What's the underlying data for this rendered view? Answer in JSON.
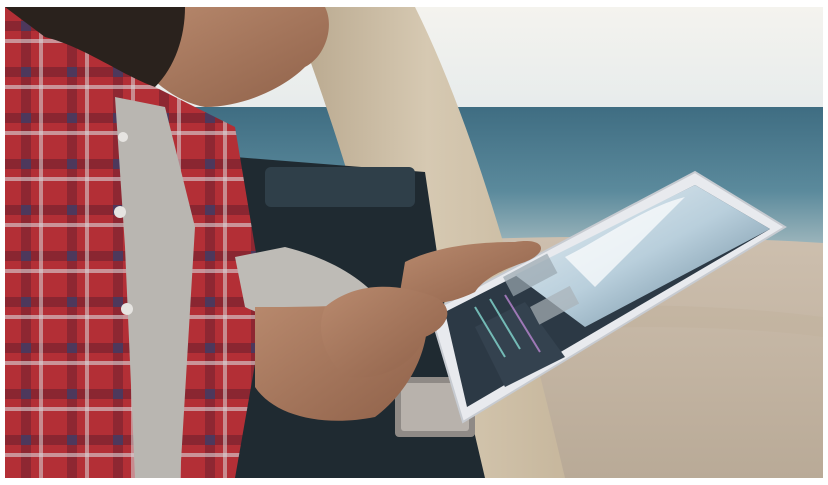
{
  "photo": {
    "scene": "beach",
    "colors": {
      "sky": "#f1f1ec",
      "sea": "#4f7f93",
      "sand": "#cfc3b2",
      "shirt": "#b7343a",
      "tablet": "#e7e9ec"
    }
  }
}
